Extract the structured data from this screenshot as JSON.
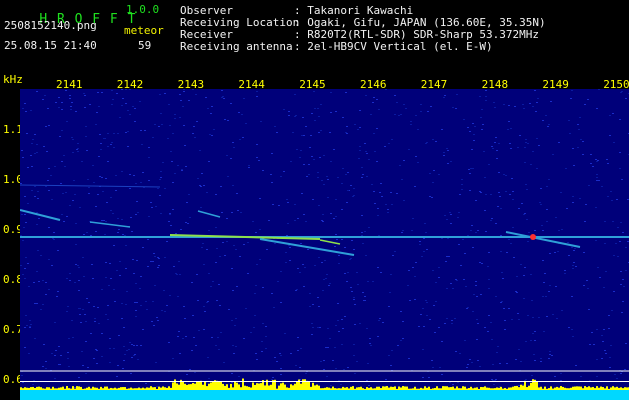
{
  "app": {
    "name": "H R O F F T",
    "version": "1.0.0"
  },
  "file": {
    "name": "2508152140.png",
    "datetime": "25.08.15 21:40"
  },
  "meteor": {
    "label": "meteor",
    "count": "59"
  },
  "info": [
    {
      "key": "Observer",
      "value": ": Takanori Kawachi"
    },
    {
      "key": "Receiving Location",
      "value": ": Ogaki, Gifu, JAPAN (136.60E, 35.35N)"
    },
    {
      "key": "Receiver",
      "value": ": R820T2(RTL-SDR) SDR-Sharp 53.372MHz"
    },
    {
      "key": "Receiving antenna",
      "value": ": 2el-HB9CV Vertical (el. E-W)"
    }
  ],
  "axes": {
    "y_unit": "kHz",
    "x_ticks": [
      "2141",
      "2142",
      "2143",
      "2144",
      "2145",
      "2146",
      "2147",
      "2148",
      "2149",
      "2150"
    ],
    "y_ticks": [
      "1.1",
      "1.0",
      "0.9",
      "0.8",
      "0.7",
      "0.6"
    ]
  },
  "colors": {
    "background": "#00007a",
    "text_green": "#1fe01f",
    "text_yellow": "#ffff00",
    "bars": "#ffff00",
    "base": "#00d8ff"
  }
}
